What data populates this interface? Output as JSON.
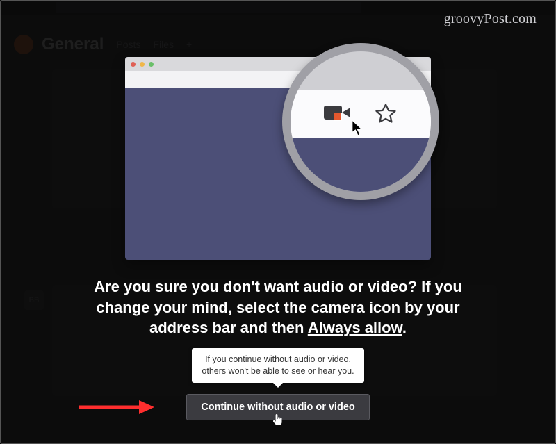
{
  "watermark": "groovyPost.com",
  "background": {
    "channel_name": "General",
    "tabs": [
      "Posts",
      "Files",
      "+"
    ],
    "initials": "BB"
  },
  "prompt": {
    "line1": "Are you sure you don't want audio or video? If you",
    "line2": "change your mind, select the camera icon by your",
    "line3_a": "address bar and then ",
    "line3_underline": "Always allow",
    "line3_b": "."
  },
  "tooltip": {
    "line1": "If you continue without audio or video,",
    "line2": "others won't be able to see or hear you."
  },
  "cta_label": "Continue without audio or video"
}
